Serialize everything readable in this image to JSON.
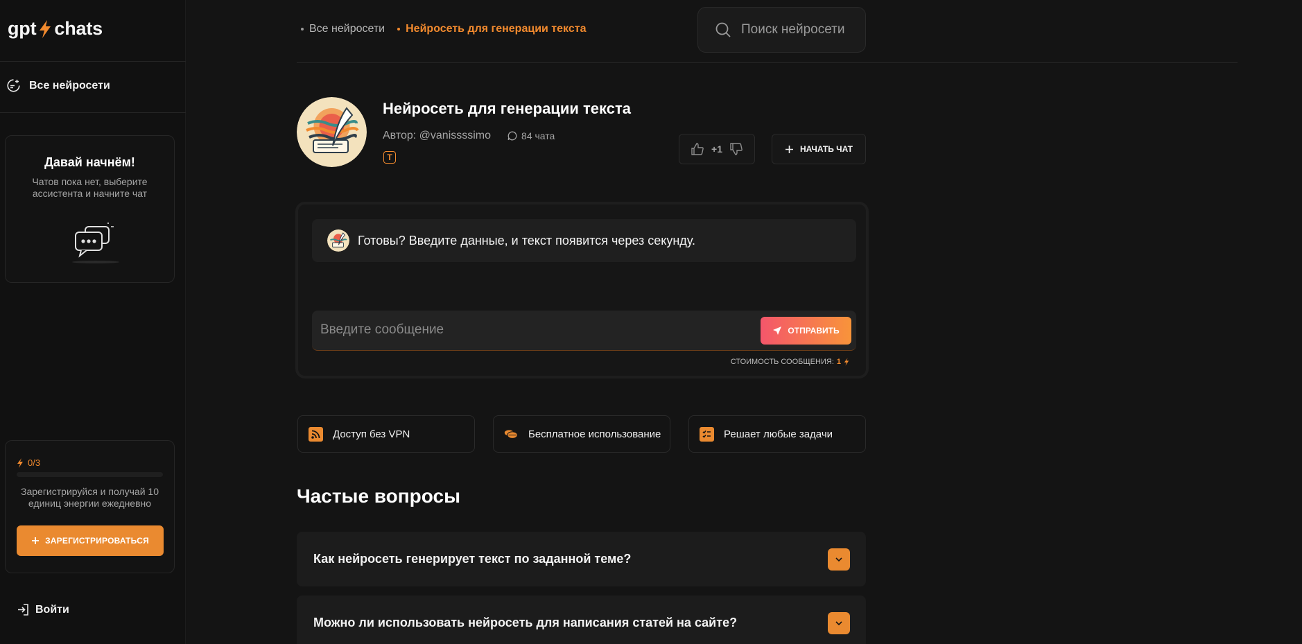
{
  "sidebar": {
    "logo_left": "gpt",
    "logo_right": "chats",
    "nav_all": "Все нейросети",
    "start_card": {
      "title": "Давай начнём!",
      "text": "Чатов пока нет, выберите ассистента и начните чат"
    },
    "energy": {
      "counter": "0/3",
      "progress": 0,
      "text": "Зарегистрируйся и получай 10 единиц энергии ежедневно",
      "register_label": "ЗАРЕГИСТРИРОВАТЬСЯ"
    },
    "login_label": "Войти"
  },
  "header": {
    "breadcrumbs": [
      "Все нейросети",
      "Нейросеть для генерации текста"
    ],
    "search_placeholder": "Поиск нейросети"
  },
  "assistant": {
    "title": "Нейросеть для генерации текста",
    "author": "Автор: @vanissssimo",
    "chats": "84 чата",
    "type_badge": "T",
    "votes": "+1",
    "start_chat_label": "НАЧАТЬ ЧАТ"
  },
  "chat": {
    "greeting": "Готовы? Введите данные, и текст появится через секунду.",
    "input_placeholder": "Введите сообщение",
    "send_label": "ОТПРАВИТЬ",
    "cost_label": "СТОИМОСТЬ СООБЩЕНИЯ:",
    "cost_value": "1"
  },
  "features": [
    {
      "label": "Доступ без VPN",
      "icon": "rss-icon"
    },
    {
      "label": "Бесплатное использование",
      "icon": "coins-icon"
    },
    {
      "label": "Решает любые задачи",
      "icon": "checklist-icon"
    }
  ],
  "faq": {
    "title": "Частые вопросы",
    "items": [
      "Как нейросеть генерирует текст по заданной теме?",
      "Можно ли использовать нейросеть для написания статей на сайте?"
    ]
  },
  "colors": {
    "accent": "#ea8a30",
    "background": "#141414",
    "sidebar": "#111111",
    "send_gradient_start": "#f4566b",
    "send_gradient_end": "#f8943a"
  }
}
